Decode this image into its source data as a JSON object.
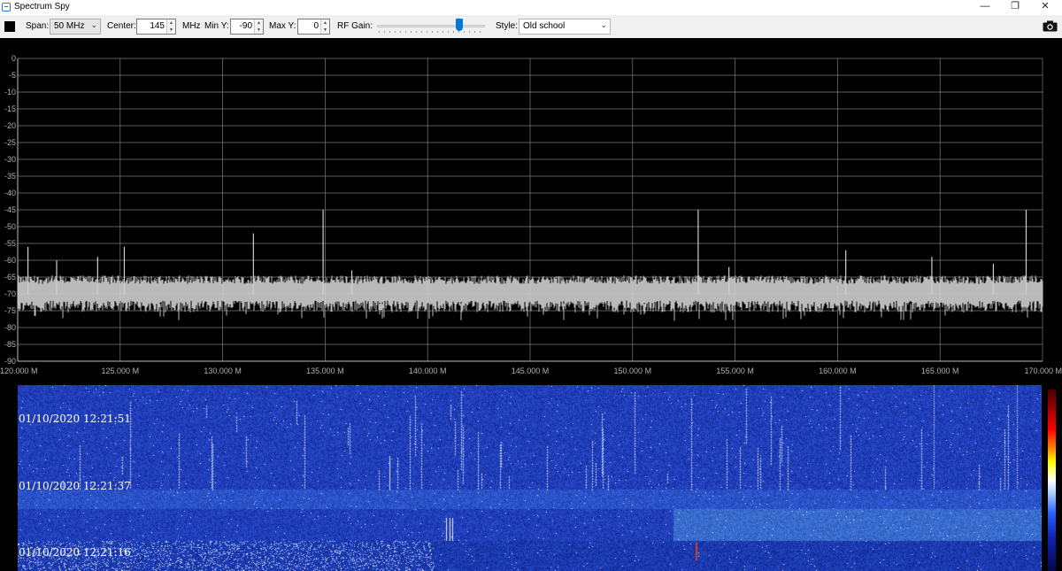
{
  "window": {
    "title": "Spectrum Spy",
    "minimize": "—",
    "restore": "❐",
    "close": "✕"
  },
  "toolbar": {
    "span_label": "Span:",
    "span_value": "50 MHz",
    "center_label": "Center:",
    "center_value": "145",
    "center_unit": "MHz",
    "min_y_label": "Min Y:",
    "min_y_value": "-90",
    "max_y_label": "Max Y:",
    "max_y_value": "0",
    "rf_gain_label": "RF Gain:",
    "rf_gain_level": 0.78,
    "style_label": "Style:",
    "style_value": "Old school"
  },
  "spectrum": {
    "y_ticks": [
      "0",
      "-5",
      "-10",
      "-15",
      "-20",
      "-25",
      "-30",
      "-35",
      "-40",
      "-45",
      "-50",
      "-55",
      "-60",
      "-65",
      "-70",
      "-75",
      "-80",
      "-85",
      "-90"
    ],
    "x_ticks": [
      "120.000 M",
      "125.000 M",
      "130.000 M",
      "135.000 M",
      "140.000 M",
      "145.000 M",
      "150.000 M",
      "155.000 M",
      "160.000 M",
      "165.000 M",
      "170.000 M"
    ],
    "ylim": [
      -90,
      0
    ],
    "xlim_mhz": [
      120,
      170
    ],
    "noise_floor_db": -70,
    "peaks": [
      {
        "f": 120.5,
        "db": -56
      },
      {
        "f": 121.9,
        "db": -60
      },
      {
        "f": 123.9,
        "db": -59
      },
      {
        "f": 125.2,
        "db": -56
      },
      {
        "f": 131.5,
        "db": -52
      },
      {
        "f": 134.9,
        "db": -45
      },
      {
        "f": 136.3,
        "db": -63
      },
      {
        "f": 153.2,
        "db": -45
      },
      {
        "f": 154.7,
        "db": -62
      },
      {
        "f": 160.4,
        "db": -57
      },
      {
        "f": 164.6,
        "db": -59
      },
      {
        "f": 167.6,
        "db": -61
      },
      {
        "f": 169.2,
        "db": -45
      }
    ]
  },
  "waterfall": {
    "timestamps": [
      "01/10/2020 12:21:51",
      "01/10/2020 12:21:37",
      "01/10/2020 12:21:16"
    ]
  },
  "colors": {
    "plot_background": "#000000",
    "grid": "#7a7a7a",
    "trace": "#d0d0d0",
    "slider_thumb": "#0078d7",
    "waterfall_base": "#1a2fb0"
  },
  "icons": {
    "app": "app-window-icon",
    "stop": "stop-icon",
    "snapshot": "camera-icon"
  }
}
